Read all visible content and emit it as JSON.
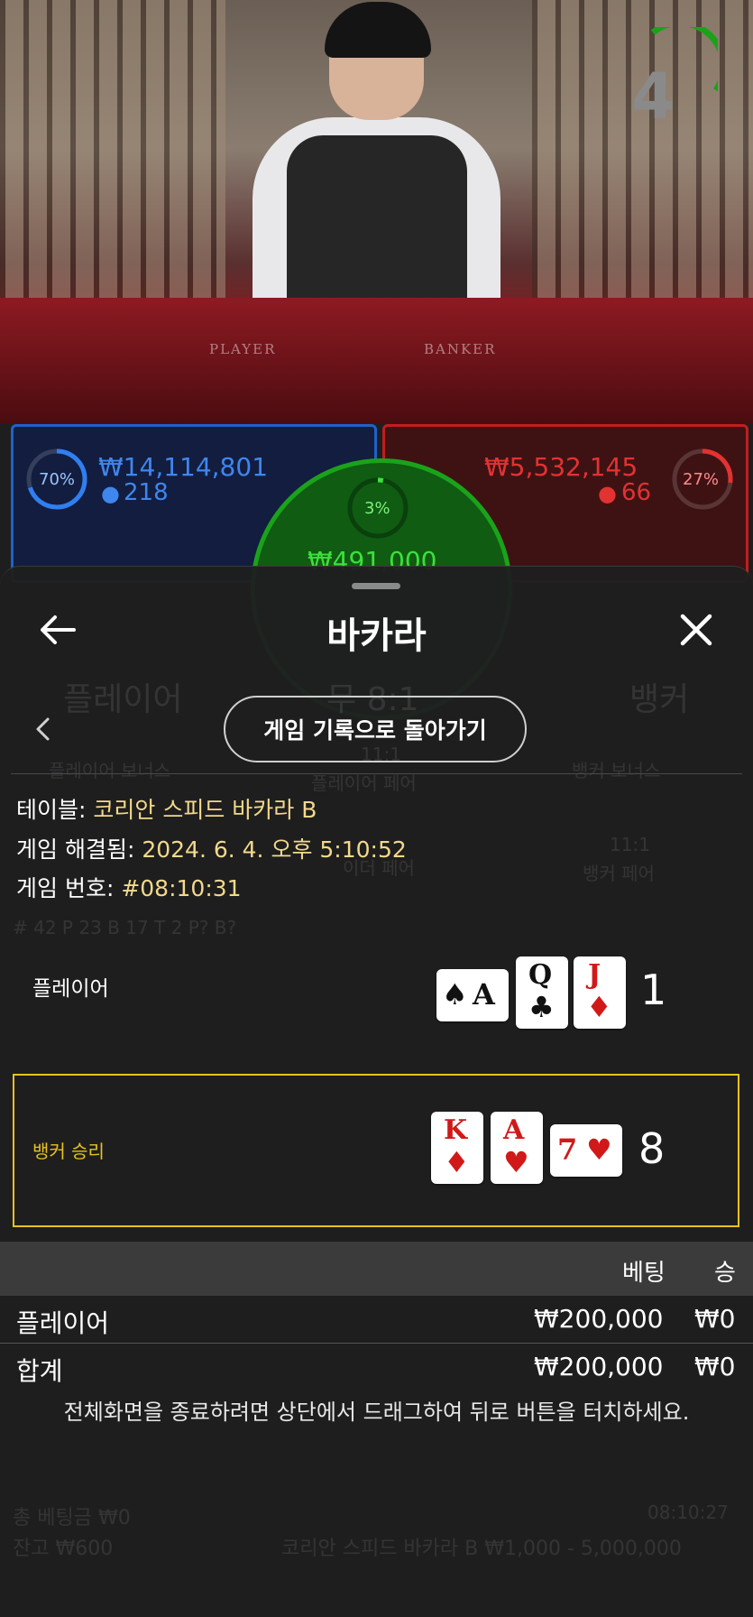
{
  "video": {
    "timer": "4",
    "felt_left": "PLAYER",
    "felt_right": "BANKER"
  },
  "bets": {
    "player": {
      "percent": "70%",
      "percent_value": 70,
      "amount": "₩14,114,801",
      "users": "218",
      "color": "#1d63c9"
    },
    "banker": {
      "percent": "27%",
      "percent_value": 27,
      "amount": "₩5,532,145",
      "users": "66",
      "color": "#c21d1d"
    },
    "tie": {
      "percent": "3%",
      "percent_value": 3,
      "amount": "₩491,000",
      "color": "#1aa31a"
    }
  },
  "background_layer": {
    "player": "플레이어",
    "tie": "무 8:1",
    "banker": "뱅커",
    "player_bonus": "플레이어 보너스",
    "player_pair": "플레이어 페어",
    "pair_ratio": "11:1",
    "banker_bonus": "뱅커 보너스",
    "either_pair": "이더 페어",
    "banker_pair_ratio": "11:1",
    "banker_pair": "뱅커 페어",
    "stats": "# 42   P 23   B 17   T 2        P?           B?",
    "total_bet": "총 베팅금 ₩0",
    "balance": "잔고 ₩600",
    "limits": "코리안 스피드 바카라 B ₩1,000 - 5,000,000",
    "game_id": "08:10:27"
  },
  "sheet": {
    "title": "바카라",
    "back_to_history": "게임 기록으로 돌아가기",
    "table_label": "테이블:",
    "table_value": "코리안 스피드 바카라 B",
    "resolved_label": "게임 해결됨:",
    "resolved_value": "2024. 6. 4. 오후 5:10:52",
    "number_label": "게임 번호:",
    "number_value": "#08:10:31",
    "player_hand": {
      "label": "플레이어",
      "score": "1",
      "cards": [
        {
          "rank": "A",
          "suit": "♠",
          "color": "#111111"
        },
        {
          "rank": "Q",
          "suit": "♣",
          "color": "#111111"
        },
        {
          "rank": "J",
          "suit": "♦",
          "color": "#d11919"
        }
      ]
    },
    "banker_hand": {
      "label": "뱅커 승리",
      "score": "8",
      "accent": "#e6c31e",
      "cards": [
        {
          "rank": "K",
          "suit": "♦",
          "color": "#d11919"
        },
        {
          "rank": "A",
          "suit": "♥",
          "color": "#d11919"
        },
        {
          "rank": "7",
          "suit": "♥",
          "color": "#d11919"
        }
      ]
    },
    "table": {
      "col_bet": "베팅",
      "col_win": "승",
      "rows": [
        {
          "name": "플레이어",
          "bet": "₩200,000",
          "win": "₩0"
        }
      ],
      "total": {
        "name": "합계",
        "bet": "₩200,000",
        "win": "₩0"
      }
    },
    "fullscreen_hint": "전체화면을 종료하려면 상단에서 드래그하여 뒤로 버튼을 터치하세요."
  }
}
